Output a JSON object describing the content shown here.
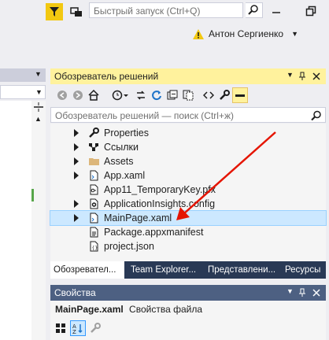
{
  "titlebar": {
    "quick_launch_placeholder": "Быстрый запуск (Ctrl+Q)",
    "user_name": "Антон Сергиенко"
  },
  "solution_explorer": {
    "title": "Обозреватель решений",
    "search_placeholder": "Обозреватель решений — поиск (Ctrl+ж)",
    "items": [
      {
        "label": "Properties",
        "icon": "wrench-icon",
        "expandable": true
      },
      {
        "label": "Ссылки",
        "icon": "references-icon",
        "expandable": true
      },
      {
        "label": "Assets",
        "icon": "folder-icon",
        "expandable": true
      },
      {
        "label": "App.xaml",
        "icon": "xaml-file-icon",
        "expandable": true
      },
      {
        "label": "App11_TemporaryKey.pfx",
        "icon": "key-file-icon",
        "expandable": false
      },
      {
        "label": "ApplicationInsights.config",
        "icon": "config-file-icon",
        "expandable": true
      },
      {
        "label": "MainPage.xaml",
        "icon": "xaml-file-icon",
        "expandable": true,
        "selected": true
      },
      {
        "label": "Package.appxmanifest",
        "icon": "manifest-file-icon",
        "expandable": false
      },
      {
        "label": "project.json",
        "icon": "json-file-icon",
        "expandable": false
      }
    ],
    "tabs": [
      {
        "label": "Обозревател...",
        "active": true
      },
      {
        "label": "Team Explorer...",
        "active": false
      },
      {
        "label": "Представлени...",
        "active": false
      },
      {
        "label": "Ресурсы",
        "active": false
      }
    ]
  },
  "properties": {
    "title": "Свойства",
    "object_name": "MainPage.xaml",
    "object_type": "Свойства файла"
  },
  "colors": {
    "active_header": "#fff29d",
    "inactive_header": "#4d6082",
    "tab_strip": "#293955",
    "selection": "#cce8ff",
    "arrow": "#e51400"
  }
}
